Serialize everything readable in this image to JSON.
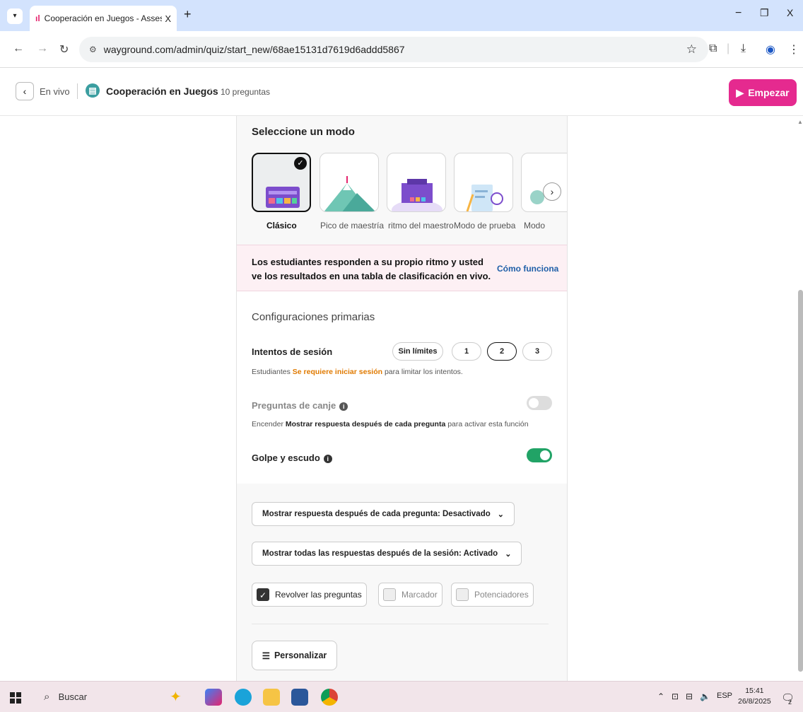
{
  "browser": {
    "tab_title": "Cooperación en Juegos - Asses",
    "tab_close": "X",
    "new_tab": "+",
    "url": "wayground.com/admin/quiz/start_new/68ae15131d7619d6addd5867",
    "win_controls": [
      "−",
      "❐",
      "X"
    ]
  },
  "header": {
    "back_label": "En vivo",
    "quiz_title": "Cooperación en Juegos",
    "question_count": "10 preguntas",
    "start_button": "Empezar"
  },
  "modes": {
    "heading": "Seleccione un modo",
    "items": [
      {
        "label": "Clásico",
        "selected": true
      },
      {
        "label": "Pico de maestría",
        "selected": false
      },
      {
        "label": "ritmo del maestro",
        "selected": false
      },
      {
        "label": "Modo de prueba",
        "selected": false
      },
      {
        "label": "Modo",
        "selected": false
      }
    ]
  },
  "info_banner": {
    "text": "Los estudiantes responden a su propio ritmo y usted ve los resultados en una tabla de clasificación en vivo.",
    "link": "Cómo funciona"
  },
  "settings": {
    "heading": "Configuraciones primarias",
    "attempts": {
      "label": "Intentos de sesión",
      "options": [
        "Sin límites",
        "1",
        "2",
        "3"
      ],
      "selected": "2",
      "note_prefix": "Estudiantes",
      "note_highlight": "Se requiere iniciar sesión",
      "note_suffix": "para limitar los intentos."
    },
    "redemption": {
      "label": "Preguntas de canje",
      "enabled": false,
      "note_prefix": "Encender",
      "note_bold": "Mostrar respuesta después de cada pregunta",
      "note_suffix": "para activar esta función"
    },
    "power": {
      "label": "Golpe y escudo",
      "enabled": true
    }
  },
  "dropdowns": {
    "show_answers_each": "Mostrar respuesta después de cada pregunta: Desactivado",
    "show_answers_session": "Mostrar todas las respuestas después de la sesión: Activado"
  },
  "checkboxes": [
    {
      "label": "Revolver las preguntas",
      "checked": true
    },
    {
      "label": "Marcador",
      "checked": false
    },
    {
      "label": "Potenciadores",
      "checked": false
    }
  ],
  "customize_button": "Personalizar",
  "taskbar": {
    "search_label": "Buscar",
    "language": "ESP",
    "time": "15:41",
    "date": "26/8/2025",
    "notification_count": "2"
  },
  "colors": {
    "accent": "#e52a8f",
    "toggle_on": "#21a366",
    "link": "#1f5fa8",
    "warning": "#e07a00"
  }
}
